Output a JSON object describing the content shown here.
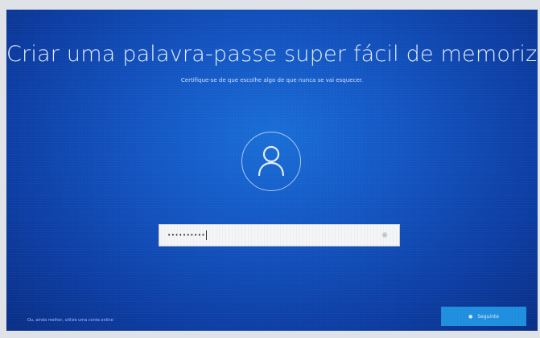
{
  "setup": {
    "title": "Criar uma palavra-passe super fácil de memorizar",
    "subtitle": "Certifique-se de que escolhe algo de que nunca se vai esquecer.",
    "avatar_icon": "user-icon",
    "password_value": "••••••••••",
    "reveal_icon": "eye-icon",
    "bottom_link": "Ou, ainda melhor, utilize uma conta online",
    "next_label": "Seguinte"
  },
  "colors": {
    "background": "#1456c4",
    "button": "#1f8fe0",
    "text": "#e8f0ff"
  }
}
